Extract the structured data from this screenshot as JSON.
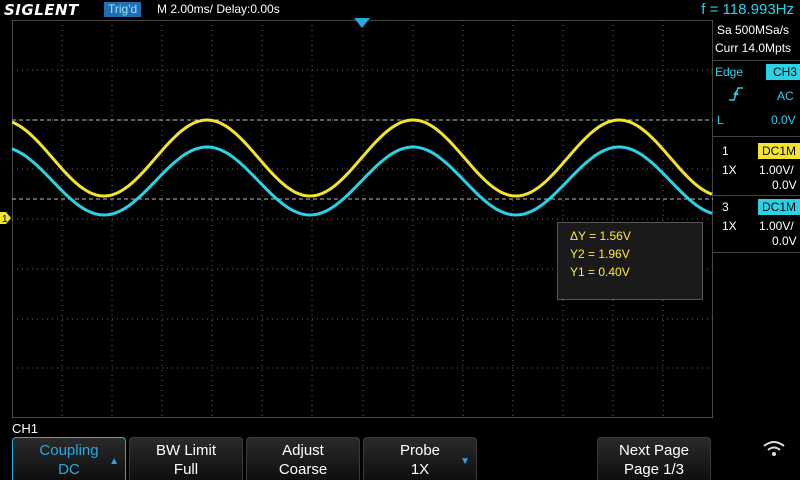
{
  "header": {
    "brand": "SIGLENT",
    "trigger_status": "Trig'd",
    "timebase": "M 2.00ms/ Delay:0.00s",
    "frequency": "f = 118.993Hz"
  },
  "acquisition": {
    "sample_rate": "Sa 500MSa/s",
    "memory_depth": "Curr 14.0Mpts"
  },
  "trigger": {
    "type": "Edge",
    "source": "CH3",
    "slope_icon": "rising-edge-icon",
    "coupling": "AC",
    "level_label": "L",
    "level": "0.0V"
  },
  "channels": [
    {
      "number": "1",
      "coupling": "DC1M",
      "probe": "1X",
      "scale": "1.00V/",
      "offset": "0.0V",
      "color": "#f4e52c"
    },
    {
      "number": "3",
      "coupling": "DC1M",
      "probe": "1X",
      "scale": "1.00V/",
      "offset": "0.0V",
      "color": "#2ad2e6"
    }
  ],
  "ch1_marker_label": "1",
  "cursor_measurement": {
    "delta_y": "ΔY = 1.56V",
    "y2": "Y2 = 1.96V",
    "y1": "Y1 = 0.40V"
  },
  "menu": {
    "title": "CH1",
    "softkeys": [
      {
        "line1": "Coupling",
        "line2": "DC"
      },
      {
        "line1": "BW Limit",
        "line2": "Full"
      },
      {
        "line1": "Adjust",
        "line2": "Coarse"
      },
      {
        "line1": "Probe",
        "line2": "1X"
      },
      {
        "line1": "Next Page",
        "line2": "Page 1/3"
      }
    ],
    "wifi_icon": "wifi-icon"
  }
}
